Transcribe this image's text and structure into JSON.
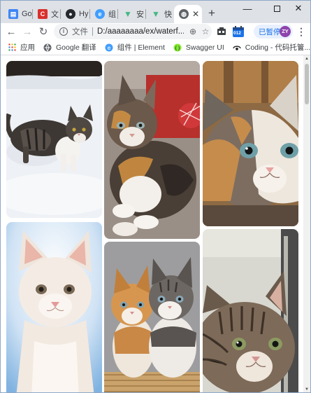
{
  "tabs": [
    {
      "label": "Go",
      "icon": "google-docs-icon"
    },
    {
      "label": "文",
      "icon": "red-c-icon"
    },
    {
      "label": "Hy",
      "icon": "github-icon"
    },
    {
      "label": "组",
      "icon": "element-icon"
    },
    {
      "label": "安",
      "icon": "vue-icon"
    },
    {
      "label": "快",
      "icon": "vue-icon"
    },
    {
      "label": "",
      "icon": "globe-icon",
      "active": true
    }
  ],
  "toolbar": {
    "file_label": "文件",
    "url": "D:/aaaaaaaa/ex/waterf...",
    "paused_label": "已暂停",
    "avatar_initials": "ZY",
    "ext_badge": "012"
  },
  "bookmarks": [
    {
      "label": "应用",
      "icon": "apps-grid-icon"
    },
    {
      "label": "Google 翻译",
      "icon": "globe-icon"
    },
    {
      "label": "组件 | Element",
      "icon": "element-icon"
    },
    {
      "label": "Swagger UI",
      "icon": "swagger-icon"
    },
    {
      "label": "Coding - 代码托管...",
      "icon": "coding-icon"
    }
  ],
  "bookmarks_more": "»",
  "gallery": [
    {
      "name": "kitten-in-snow-photo",
      "column": 1
    },
    {
      "name": "kitten-white-photo",
      "column": 1
    },
    {
      "name": "kitten-red-ball-photo",
      "column": 2
    },
    {
      "name": "two-kittens-photo",
      "column": 2
    },
    {
      "name": "kitten-calico-face-photo",
      "column": 3
    },
    {
      "name": "kitten-window-photo",
      "column": 3
    }
  ],
  "colors": {
    "tabstrip": "#dee1e6",
    "accent": "#1a73e8",
    "avatar": "#8e44ad"
  }
}
